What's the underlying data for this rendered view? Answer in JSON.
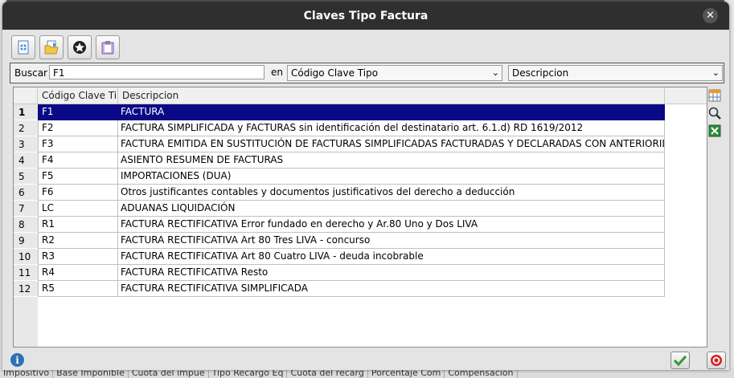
{
  "dialog": {
    "title": "Claves Tipo Factura"
  },
  "search": {
    "label": "Buscar",
    "value": "F1",
    "in_label": "en",
    "field_select": "Código Clave Tipo",
    "order_select": "Descripcion"
  },
  "grid": {
    "columns": [
      "Código Clave Tipo",
      "Descripcion"
    ],
    "rows": [
      {
        "n": "1",
        "code": "F1",
        "desc": "FACTURA"
      },
      {
        "n": "2",
        "code": "F2",
        "desc": "FACTURA SIMPLIFICADA y FACTURAS sin identificación del destinatario art. 6.1.d) RD 1619/2012"
      },
      {
        "n": "3",
        "code": "F3",
        "desc": "FACTURA EMITIDA EN SUSTITUCIÓN DE FACTURAS SIMPLIFICADAS FACTURADAS Y DECLARADAS CON ANTERIORIDAD"
      },
      {
        "n": "4",
        "code": "F4",
        "desc": "ASIENTO RESUMEN DE FACTURAS"
      },
      {
        "n": "5",
        "code": "F5",
        "desc": "IMPORTACIONES (DUA)"
      },
      {
        "n": "6",
        "code": "F6",
        "desc": "Otros justificantes contables y documentos justificativos del derecho a deducción"
      },
      {
        "n": "7",
        "code": "LC",
        "desc": "ADUANAS LIQUIDACIÓN"
      },
      {
        "n": "8",
        "code": "R1",
        "desc": "FACTURA RECTIFICATIVA Error fundado en derecho y Ar.80 Uno y Dos LIVA"
      },
      {
        "n": "9",
        "code": "R2",
        "desc": "FACTURA RECTIFICATIVA Art 80 Tres LIVA - concurso"
      },
      {
        "n": "10",
        "code": "R3",
        "desc": "FACTURA RECTIFICATIVA Art 80 Cuatro LIVA - deuda incobrable"
      },
      {
        "n": "11",
        "code": "R4",
        "desc": "FACTURA RECTIFICATIVA Resto"
      },
      {
        "n": "12",
        "code": "R5",
        "desc": "FACTURA RECTIFICATIVA SIMPLIFICADA"
      }
    ],
    "selected_row": "1"
  },
  "background_footer": [
    "Impositivo",
    "Base Imponible",
    "Cuota del impue",
    "Tipo Recargo Eq",
    "Cuota del recarg",
    "Porcentaje Com",
    "Compensación"
  ],
  "icons": {
    "toolbar": [
      "new-record-icon",
      "open-folder-icon",
      "filter-icon",
      "clipboard-icon"
    ],
    "side": [
      "columns-config-icon",
      "magnifier-icon",
      "excel-export-icon"
    ]
  },
  "colors": {
    "selection": "#0a0a86",
    "titlebar": "#2f2f2f"
  }
}
